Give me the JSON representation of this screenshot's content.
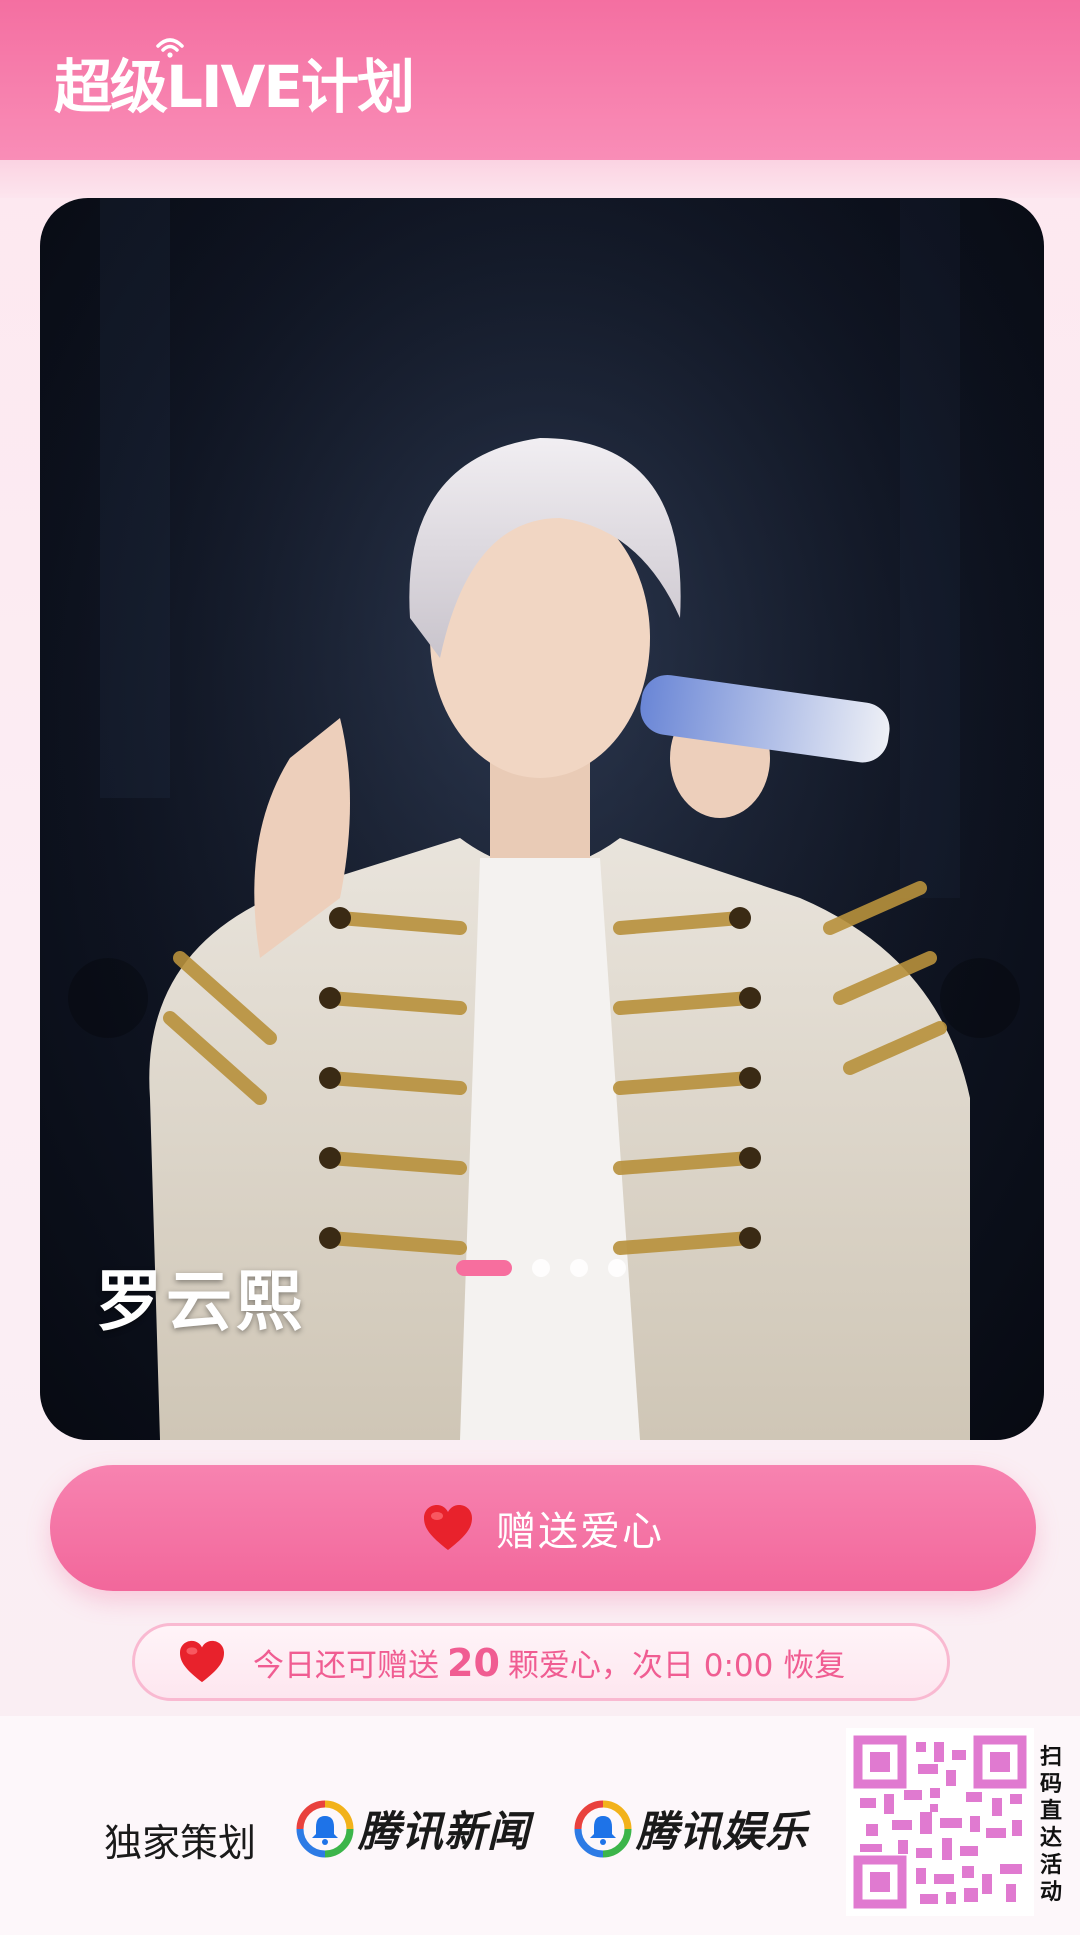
{
  "header": {
    "brand": "超级LIVE计划"
  },
  "photo": {
    "artist_name": "罗云熙",
    "carousel_total": 4,
    "carousel_active_index": 0
  },
  "actions": {
    "give_love_label": "赠送爱心"
  },
  "quota": {
    "prefix": "今日还可赠送",
    "count": "20",
    "suffix": "颗爱心，次日 0:00 恢复"
  },
  "footer": {
    "sponsor_label": "独家策划",
    "logo_news": "腾讯新闻",
    "logo_ent": "腾讯娱乐",
    "scan_text": "扫码直达活动"
  },
  "colors": {
    "accent_pink": "#f2679b",
    "header_pink": "#f46fa1",
    "heart_red": "#e8222c"
  },
  "icons": {
    "heart": "heart-icon",
    "wifi": "signal-icon",
    "tencent_logo": "tencent-bell-logo"
  }
}
